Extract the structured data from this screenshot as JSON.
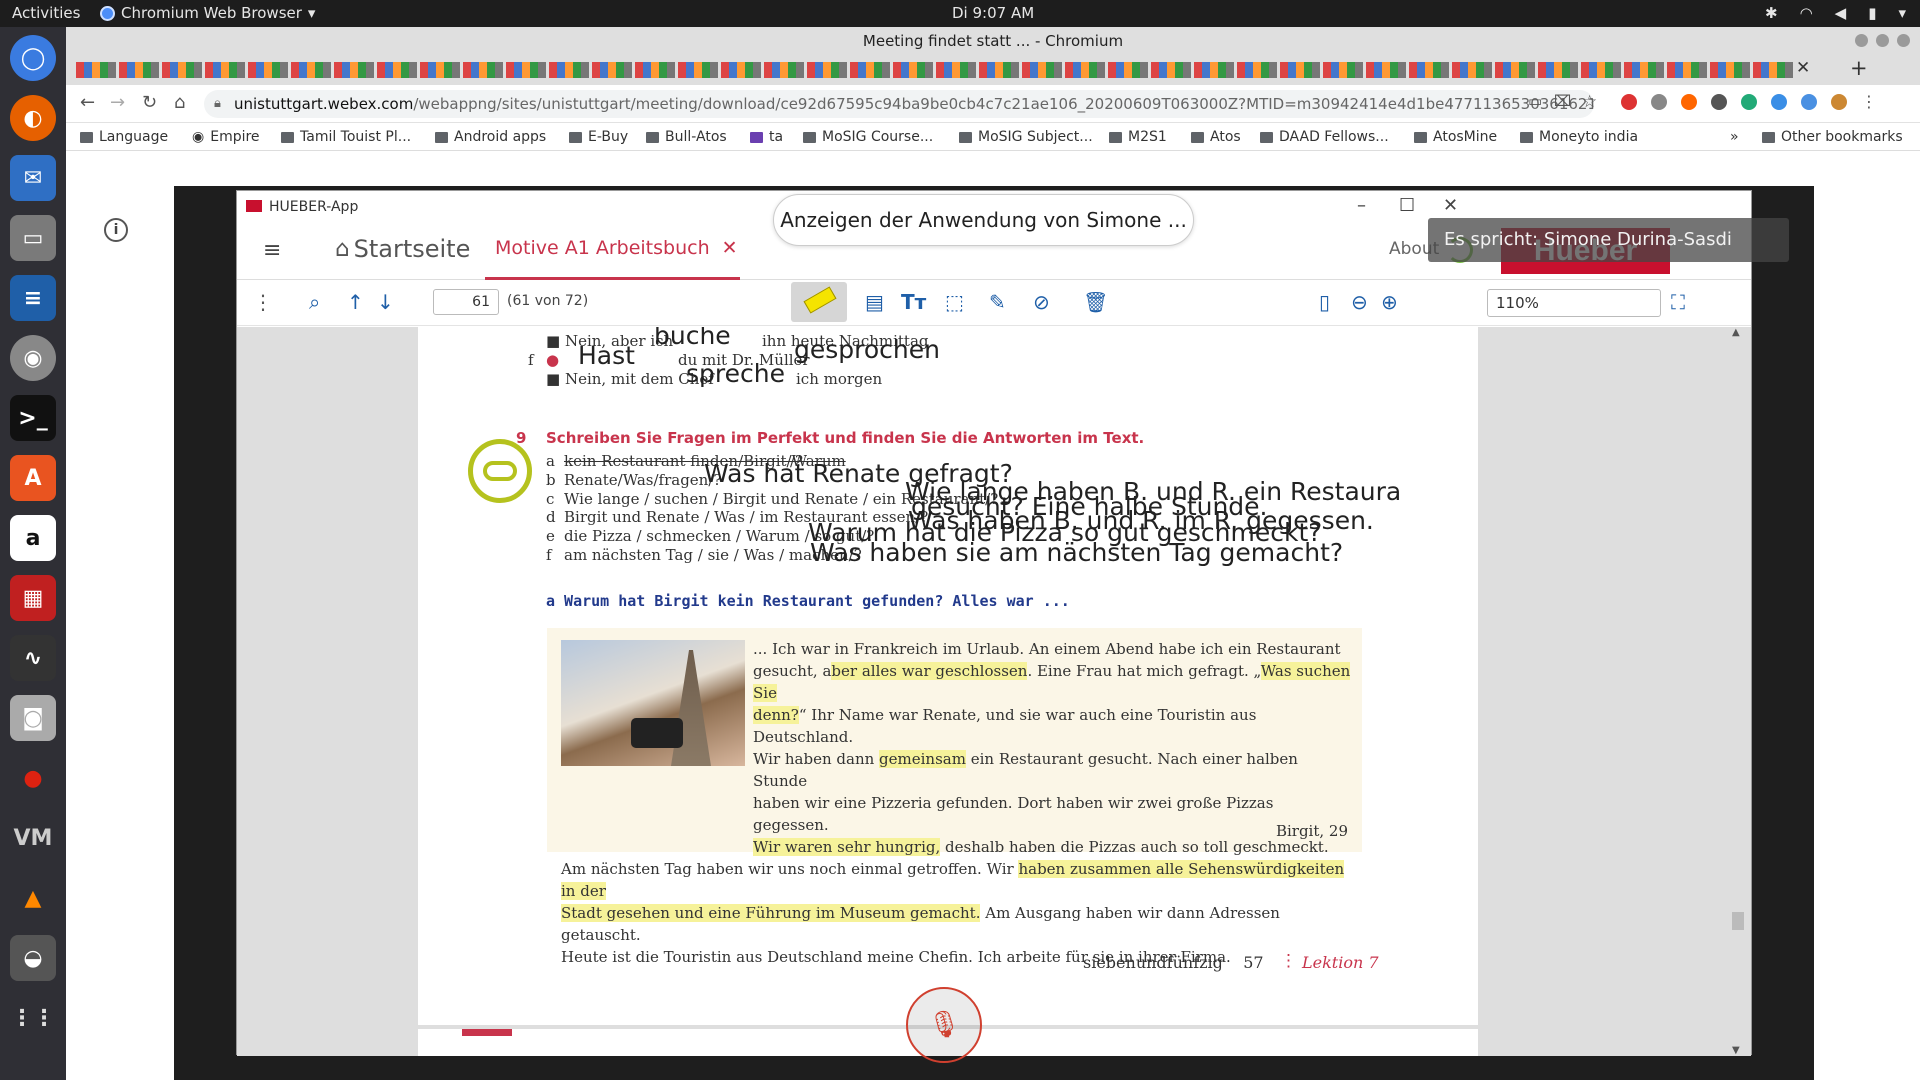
{
  "system": {
    "activities": "Activities",
    "app_name": "Chromium Web Browser",
    "clock": "Di  9:07 AM"
  },
  "browser": {
    "window_title": "Meeting findet statt ... - Chromium",
    "url_host": "unistuttgart.webex.com",
    "url_rest": "/webappng/sites/unistuttgart/meeting/download/ce92d67595c94ba9be0cb4c7c21ae106_20200609T063000Z?MTID=m30942414e4d1be477113653036162165&launchApp...",
    "bookmarks": [
      "Language",
      "Empire",
      "Tamil Touist Pl...",
      "Android apps",
      "E-Buy",
      "Bull-Atos",
      "ta",
      "MoSIG Course...",
      "MoSIG Subject...",
      "M2S1",
      "Atos",
      "DAAD Fellows...",
      "AtosMine",
      "Moneyto india"
    ],
    "other_bookmarks": "Other bookmarks",
    "overflow": "»"
  },
  "meeting": {
    "share_banner": "Anzeigen der Anwendung von Simone ...",
    "speaker_label": "Es spricht: Simone Durina-Sasdi"
  },
  "hueber": {
    "window_title": "HUEBER-App",
    "home_label": "Startseite",
    "book_tab": "Motive A1 Arbeitsbuch",
    "about": "About",
    "logo_text": "Hueber",
    "page_input": "61",
    "page_count": "(61 von 72)",
    "zoom": "110%"
  },
  "page": {
    "top_lines": [
      {
        "bullet": "■",
        "before": "Nein, aber ich",
        "handwritten": "buche",
        "after": "ihn heute Nachmittag"
      },
      {
        "letter": "f",
        "bullet": "●",
        "handwritten1": "Hast",
        "middle": "du mit Dr. Müller",
        "handwritten2": "gesprochen"
      },
      {
        "bullet": "■",
        "before": "Nein, mit dem Chef",
        "handwritten": "spreche",
        "after": "ich morgen"
      }
    ],
    "exercise_number": "9",
    "exercise_title": "Schreiben Sie Fragen im Perfekt und finden Sie die Antworten im Text.",
    "items": [
      {
        "letter": "a",
        "text": "kein Restaurant finden/Birgit/Warum",
        "suffix": "/?",
        "answer": ""
      },
      {
        "letter": "b",
        "text": "Renate/Was/fragen/?",
        "answer": "Was hat Renate gefragt?"
      },
      {
        "letter": "c",
        "text": "Wie lange / suchen / Birgit und Renate / ein Restaurant/?",
        "answer": "Wie lange haben B. und R. ein Restaura"
      },
      {
        "letter": "d",
        "text": "Birgit und Renate / Was / im Restaurant essen/?",
        "answer": "gesucht? Eine halbe Stunde."
      },
      {
        "letter": "e",
        "text": "die Pizza / schmecken / Warum / so gut/?",
        "answer": "Was haben B. und R. im R. gegessen."
      },
      {
        "letter": "f",
        "text": "am nächsten Tag / sie / Was / machen/?",
        "answer": "Warum hat die Pizza so gut geschmeckt?"
      }
    ],
    "last_answer": "Was haben sie am nächsten Tag gemacht?",
    "example_answer": "a  Warum hat Birgit kein Restaurant gefunden? Alles war ...",
    "story": {
      "l1": "... Ich war in Frankreich im Urlaub. An einem Abend habe ich ein Restaurant",
      "l2a": "gesucht, a",
      "l2b": "ber alles war geschlossen",
      "l2c": ". Eine Frau hat mich gefragt. „",
      "l2d": "Was suchen Sie",
      "l3a": "denn?",
      "l3b": "“ Ihr Name war Renate, und sie war auch eine Touristin aus Deutschland.",
      "l4a": "Wir haben dann ",
      "l4b": "gemeinsam",
      "l4c": " ein Restaurant gesucht. Nach einer halben Stunde",
      "l5": "haben wir eine Pizzeria gefunden. Dort haben wir zwei große Pizzas gegessen.",
      "l6a": "Wir waren sehr hungrig,",
      "l6b": " deshalb haben die Pizzas auch so toll geschmeckt.",
      "l7a": "Am nächsten Tag haben wir uns noch einmal getroffen. Wir ",
      "l7b": "haben zusammen alle Sehenswürdigkeiten in der",
      "l8a": "Stadt gesehen und eine Führung im Museum gemacht.",
      "l8b": " Am Ausgang haben wir dann Adressen getauscht.",
      "l9": "Heute ist die Touristin aus Deutschland meine Chefin. Ich arbeite für sie in ihrer Firma.",
      "signature": "Birgit, 29"
    },
    "footer_word": "siebenundfünfzig",
    "footer_num": "57",
    "footer_sep": "⋮",
    "footer_lesson": "Lektion 7"
  },
  "colors": {
    "hueber_red": "#c8102e",
    "exercise_pink": "#c8344c",
    "highlight": "#f6f29a"
  }
}
